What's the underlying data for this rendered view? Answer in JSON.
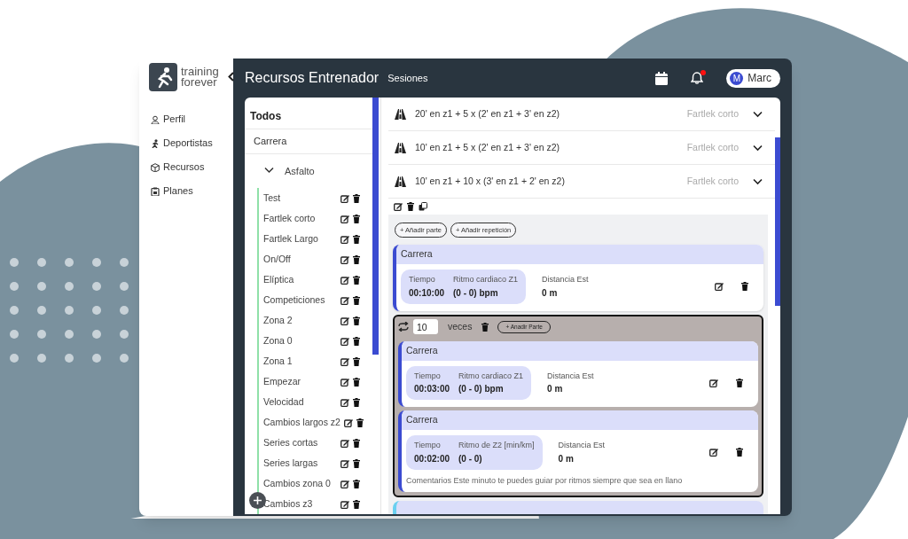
{
  "brand": {
    "line1": "training",
    "line2": "forever"
  },
  "nav": [
    {
      "label": "Perfil"
    },
    {
      "label": "Deportistas"
    },
    {
      "label": "Recursos"
    },
    {
      "label": "Planes"
    }
  ],
  "header": {
    "title": "Recursos Entrenador",
    "subtitle": "Sesiones",
    "notification": true,
    "user": {
      "initial": "M",
      "name": "Marc"
    }
  },
  "categories": {
    "title": "Todos",
    "tree": [
      {
        "label": "Carrera",
        "children": [
          {
            "label": "Asfalto",
            "expanded": true,
            "children": [
              {
                "label": "Test"
              },
              {
                "label": "Fartlek corto"
              },
              {
                "label": "Fartlek Largo"
              },
              {
                "label": "On/Off"
              },
              {
                "label": "Elíptica"
              },
              {
                "label": "Competiciones"
              },
              {
                "label": "Zona 2"
              },
              {
                "label": "Zona 0"
              },
              {
                "label": "Zona 1"
              },
              {
                "label": "Empezar"
              },
              {
                "label": "Velocidad"
              },
              {
                "label": "Cambios largos z2"
              },
              {
                "label": "Series cortas"
              },
              {
                "label": "Series largas"
              },
              {
                "label": "Cambios zona 0"
              },
              {
                "label": "Cambios z3"
              }
            ]
          }
        ]
      }
    ]
  },
  "sessions": [
    {
      "title": "20' en z1 + 5 x (2' en z1 + 3' en z2)",
      "category": "Fartlek corto"
    },
    {
      "title": "10' en z1 + 5 x (2' en z1 + 3' en z2)",
      "category": "Fartlek corto"
    },
    {
      "title": "10' en z1 + 10 x (3' en z1 + 2' en z2)",
      "category": "Fartlek corto",
      "detail": {
        "buttons": [
          "+ Añadir parte",
          "+ Añadir repetición"
        ],
        "blocks": [
          {
            "kind": "part",
            "title": "Carrera",
            "metrics": [
              {
                "label": "Tiempo",
                "value": "00:10:00"
              },
              {
                "label": "Ritmo cardiaco Z1",
                "value": "(0 - 0) bpm"
              }
            ],
            "extra": {
              "label": "Distancia Est",
              "value": "0 m"
            }
          },
          {
            "kind": "repeat",
            "count": "10",
            "unit": "veces",
            "button": "+ Anadir Parte",
            "parts": [
              {
                "title": "Carrera",
                "metrics": [
                  {
                    "label": "Tiempo",
                    "value": "00:03:00"
                  },
                  {
                    "label": "Ritmo cardiaco Z1",
                    "value": "(0 - 0) bpm"
                  }
                ],
                "extra": {
                  "label": "Distancia Est",
                  "value": "0 m"
                }
              },
              {
                "title": "Carrera",
                "metrics": [
                  {
                    "label": "Tiempo",
                    "value": "00:02:00"
                  },
                  {
                    "label": "Ritmo de Z2 [min/km]",
                    "value": "(0 - 0)"
                  }
                ],
                "extra": {
                  "label": "Distancia Est",
                  "value": "0 m"
                },
                "comment": "Comentarios Este minuto te puedes guiar por ritmos siempre que sea en llano"
              }
            ]
          }
        ]
      }
    }
  ]
}
